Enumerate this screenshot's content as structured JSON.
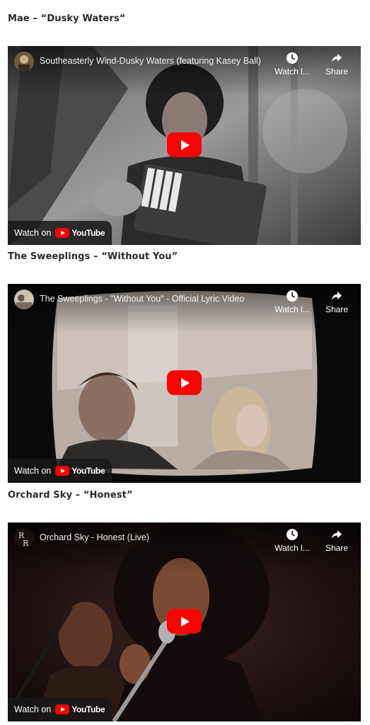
{
  "videos": [
    {
      "heading": "Mae – “Dusky Waters“",
      "title": "Southeasterly Wind-Dusky Waters (featuring Kasey Ball)",
      "watch_later_label": "Watch l...",
      "share_label": "Share",
      "watch_on_label": "Watch on",
      "youtube_label": "YouTube",
      "avatar_icon": "channel-avatar-photo"
    },
    {
      "heading": "The Sweeplings – “Without You”",
      "title": "The Sweeplings - \"Without You\" - Official Lyric Video",
      "watch_later_label": "Watch l...",
      "share_label": "Share",
      "watch_on_label": "Watch on",
      "youtube_label": "YouTube",
      "avatar_icon": "channel-avatar-photo"
    },
    {
      "heading": "Orchard Sky – “Honest”",
      "title": "Orchard Sky - Honest (Live)",
      "watch_later_label": "Watch l...",
      "share_label": "Share",
      "watch_on_label": "Watch on",
      "youtube_label": "YouTube",
      "avatar_icon": "channel-logo-rr"
    }
  ],
  "colors": {
    "youtube_red": "#ff0000",
    "heading_text": "#2a2a2a",
    "overlay_bar": "#171717"
  }
}
